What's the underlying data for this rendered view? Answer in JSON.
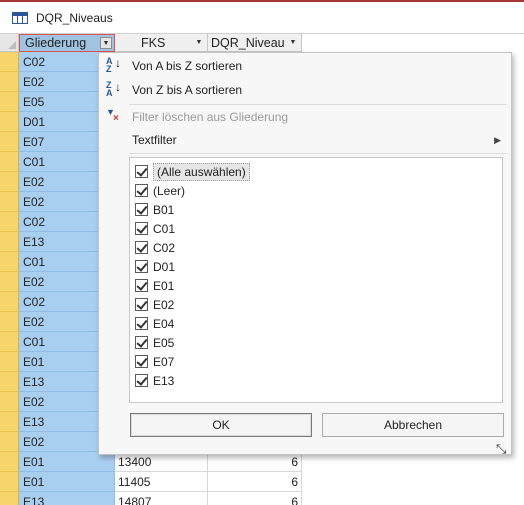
{
  "window": {
    "title": "DQR_Niveaus"
  },
  "columns": [
    {
      "label": "Gliederung"
    },
    {
      "label": "FKS"
    },
    {
      "label": "DQR_Niveau"
    }
  ],
  "rows": [
    {
      "g": "C02",
      "f": "",
      "d": ""
    },
    {
      "g": "E02",
      "f": "",
      "d": ""
    },
    {
      "g": "E05",
      "f": "",
      "d": ""
    },
    {
      "g": "D01",
      "f": "",
      "d": ""
    },
    {
      "g": "E07",
      "f": "",
      "d": ""
    },
    {
      "g": "C01",
      "f": "",
      "d": ""
    },
    {
      "g": "E02",
      "f": "",
      "d": ""
    },
    {
      "g": "E02",
      "f": "",
      "d": ""
    },
    {
      "g": "C02",
      "f": "",
      "d": ""
    },
    {
      "g": "E13",
      "f": "",
      "d": ""
    },
    {
      "g": "C01",
      "f": "",
      "d": ""
    },
    {
      "g": "E02",
      "f": "",
      "d": ""
    },
    {
      "g": "C02",
      "f": "",
      "d": ""
    },
    {
      "g": "E02",
      "f": "",
      "d": ""
    },
    {
      "g": "C01",
      "f": "",
      "d": ""
    },
    {
      "g": "E01",
      "f": "",
      "d": ""
    },
    {
      "g": "E13",
      "f": "",
      "d": ""
    },
    {
      "g": "E02",
      "f": "",
      "d": ""
    },
    {
      "g": "E13",
      "f": "",
      "d": ""
    },
    {
      "g": "E02",
      "f": "",
      "d": ""
    },
    {
      "g": "E01",
      "f": "13400",
      "d": "6"
    },
    {
      "g": "E01",
      "f": "11405",
      "d": "6"
    },
    {
      "g": "E13",
      "f": "14807",
      "d": "6"
    }
  ],
  "menu": {
    "sort_az": "Von A bis Z sortieren",
    "sort_za": "Von Z bis A sortieren",
    "clear_filter": "Filter löschen aus Gliederung",
    "text_filter": "Textfilter",
    "options": [
      "(Alle auswählen)",
      "(Leer)",
      "B01",
      "C01",
      "C02",
      "D01",
      "E01",
      "E02",
      "E04",
      "E05",
      "E07",
      "E13"
    ],
    "ok": "OK",
    "cancel": "Abbrechen"
  },
  "icons": {
    "table": "table-icon",
    "sort_az": "sort-ascending-icon",
    "sort_za": "sort-descending-icon",
    "clear_filter": "clear-filter-icon",
    "submenu": "chevron-right-icon",
    "dropdown": "dropdown-arrow-icon",
    "resize": "resize-grip-icon"
  },
  "colors": {
    "accent": "#a4373a",
    "selected_column": "#a9cff0",
    "record_selector": "#f6d66a",
    "active_header_border": "#d9534f"
  }
}
